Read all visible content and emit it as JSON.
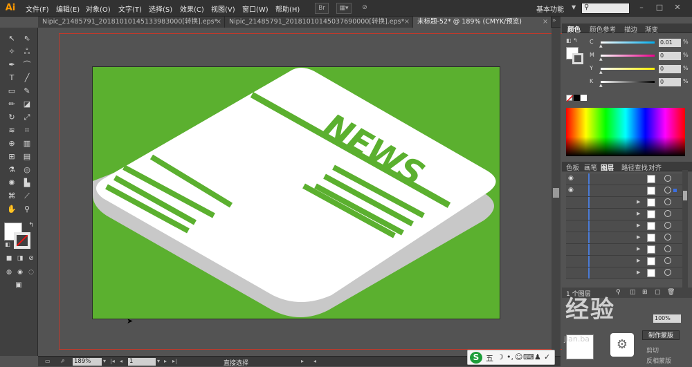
{
  "app": {
    "logo": "Ai"
  },
  "menu": [
    "文件(F)",
    "编辑(E)",
    "对象(O)",
    "文字(T)",
    "选择(S)",
    "效果(C)",
    "视图(V)",
    "窗口(W)",
    "帮助(H)"
  ],
  "menubar_icons": {
    "bridge": "Br",
    "arrange": "arrange-documents-icon",
    "gpu": "gpu-icon"
  },
  "workspace": "基本功能",
  "search": {
    "placeholder": ""
  },
  "tabs": [
    {
      "label": "Nipic_21485791_20181010145133983000[转换].eps*",
      "active": false
    },
    {
      "label": "Nipic_21485791_20181010145037690000[转换].eps*",
      "active": false
    },
    {
      "label": "未标题-52* @ 189% (CMYK/预览)",
      "active": true
    }
  ],
  "artboard": {
    "headline": "NEWS",
    "background_color": "#5bb02f",
    "paper_color": "#ffffff",
    "edge_color": "#c8c8c8"
  },
  "status": {
    "zoom": "189%",
    "page": "1",
    "tool": "直接选择"
  },
  "panel_tabs_color": [
    "颜色",
    "颜色参考",
    "描边",
    "渐变"
  ],
  "color": {
    "channels": [
      {
        "label": "C",
        "value": "0.01",
        "gradient": "linear-gradient(to right,#fff,#00aeef)"
      },
      {
        "label": "M",
        "value": "0",
        "gradient": "linear-gradient(to right,#fff,#ec008c)"
      },
      {
        "label": "Y",
        "value": "0",
        "gradient": "linear-gradient(to right,#fff,#fff200)"
      },
      {
        "label": "K",
        "value": "0",
        "gradient": "linear-gradient(to right,#fff,#000)"
      }
    ],
    "unit": "%"
  },
  "panel_tabs_layers": [
    "色板",
    "画笔",
    "图层",
    "路径查找",
    "对齐"
  ],
  "layers": {
    "footer": "1 个图层"
  },
  "ime": {
    "label": "五"
  },
  "watermark": {
    "text": "经验",
    "url": "jian.ba"
  },
  "transparency": {
    "opacity": "100%",
    "make_mask": "制作蒙版",
    "clip": "剪切",
    "invert": "反相蒙版"
  }
}
